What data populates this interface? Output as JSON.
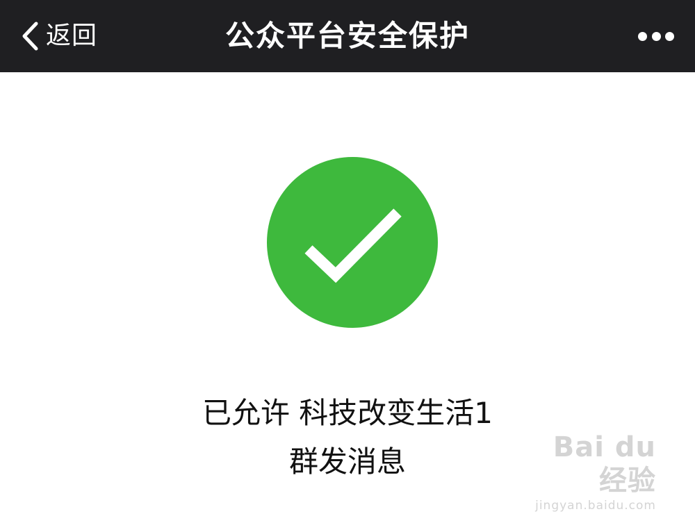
{
  "header": {
    "back_label": "返回",
    "title": "公众平台安全保护",
    "more_icon": "more-dots-icon",
    "background": "#1f1f22"
  },
  "main": {
    "status_icon": "success-check-icon",
    "status_color": "#3eb93d",
    "status_line1": "已允许 科技改变生活1",
    "status_line2": "群发消息"
  },
  "watermark": {
    "brand": "Bai du 经验",
    "url": "jingyan.baidu.com"
  }
}
